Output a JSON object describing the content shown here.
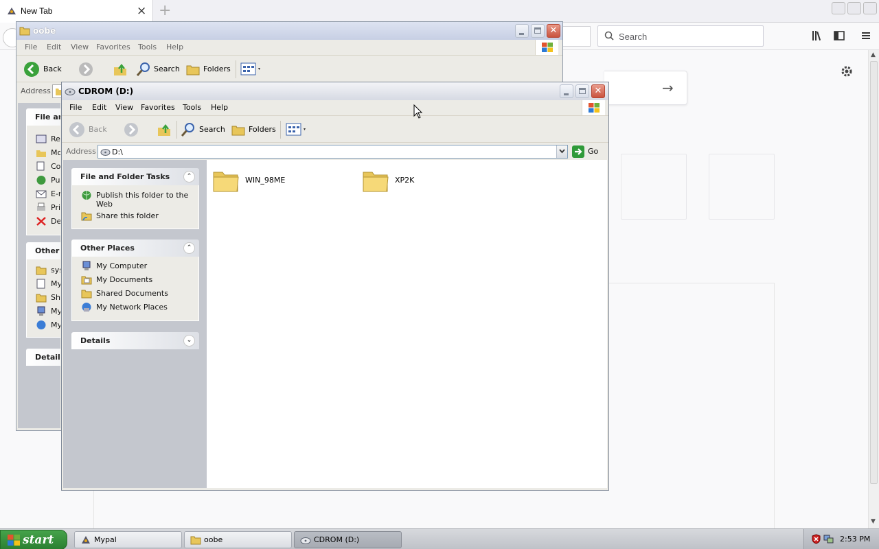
{
  "browser": {
    "tab_title": "New Tab",
    "tab_close": "×",
    "new_tab": "+",
    "search_placeholder": "Search"
  },
  "oobe_window": {
    "title": "oobe",
    "menu": [
      "File",
      "Edit",
      "View",
      "Favorites",
      "Tools",
      "Help"
    ],
    "toolbar": {
      "back": "Back",
      "search": "Search",
      "folders": "Folders"
    },
    "address_label": "Address",
    "pane_headers": [
      "File an",
      "Other",
      "Details"
    ],
    "tasks": [
      "Re",
      "Mo",
      "Co",
      "Pul",
      "E-r",
      "Pri",
      "De"
    ],
    "places": [
      "sys",
      "My",
      "Sha",
      "My",
      "My"
    ]
  },
  "cdrom_window": {
    "title": "CDROM (D:)",
    "menu": {
      "file": "File",
      "edit": "Edit",
      "view": "View",
      "favorites": "Favorites",
      "tools": "Tools",
      "help": "Help"
    },
    "toolbar": {
      "back": "Back",
      "search": "Search",
      "folders": "Folders"
    },
    "address": {
      "label": "Address",
      "value": "D:\\",
      "go": "Go"
    },
    "file_tasks": {
      "header": "File and Folder Tasks",
      "items": [
        "Publish this folder to the Web",
        "Share this folder"
      ]
    },
    "other_places": {
      "header": "Other Places",
      "items": [
        "My Computer",
        "My Documents",
        "Shared Documents",
        "My Network Places"
      ]
    },
    "details": {
      "header": "Details"
    },
    "folders": [
      "WIN_98ME",
      "XP2K"
    ]
  },
  "taskbar": {
    "start": "start",
    "tasks": [
      "Mypal",
      "oobe",
      "CDROM (D:)"
    ],
    "clock": "2:53 PM"
  }
}
